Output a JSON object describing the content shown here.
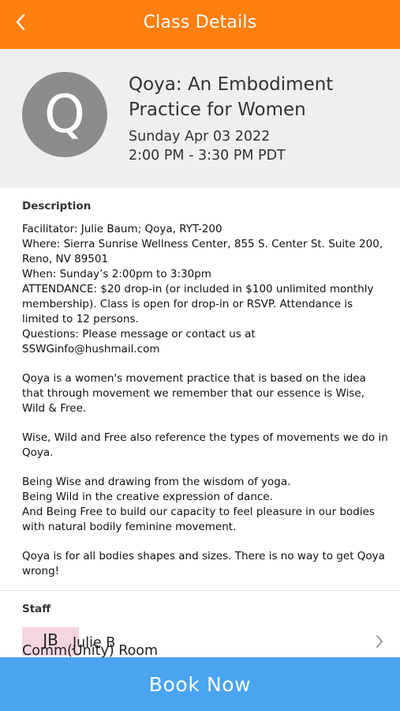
{
  "header": {
    "title": "Class Details"
  },
  "class": {
    "avatar_letter": "Q",
    "title": "Qoya: An Embodiment Practice for Women",
    "date": "Sunday Apr 03 2022",
    "time": "2:00 PM - 3:30 PM PDT"
  },
  "description": {
    "heading": "Description",
    "lines": [
      "Facilitator: Julie Baum; Qoya, RYT-200",
      "Where: Sierra Sunrise Wellness Center, 855 S. Center St. Suite 200, Reno, NV 89501",
      "When: Sunday’s 2:00pm to 3:30pm",
      "ATTENDANCE: $20 drop-in (or included in $100 unlimited monthly membership). Class is open for drop-in or RSVP. Attendance is limited to 12 persons.",
      "Questions: Please message or contact us at SSWGinfo@hushmail.com"
    ],
    "para1": "Qoya is a women's movement practice that is based on the idea that through movement we remember that our essence is Wise, Wild & Free.",
    "para2": "Wise, Wild and Free also reference the types of movements we do in Qoya.",
    "para3_lines": [
      "Being Wise and drawing from the wisdom of yoga.",
      "Being Wild in the creative expression of dance.",
      "And Being Free to build our capacity to feel pleasure in our bodies with natural bodily feminine movement."
    ],
    "para4": "Qoya is for all bodies shapes and sizes.  There is no way to get Qoya wrong!"
  },
  "staff": {
    "heading": "Staff",
    "initials": "JB",
    "name": "Julie B",
    "room": "Comm(Unity) Room"
  },
  "book_button": "Book Now",
  "colors": {
    "topbar": "#ff7f0f",
    "book_button": "#4aa4ef",
    "header_card": "#efefef",
    "avatar": "#8c8c8c",
    "staff_initials_bg": "#f6d5e3"
  }
}
